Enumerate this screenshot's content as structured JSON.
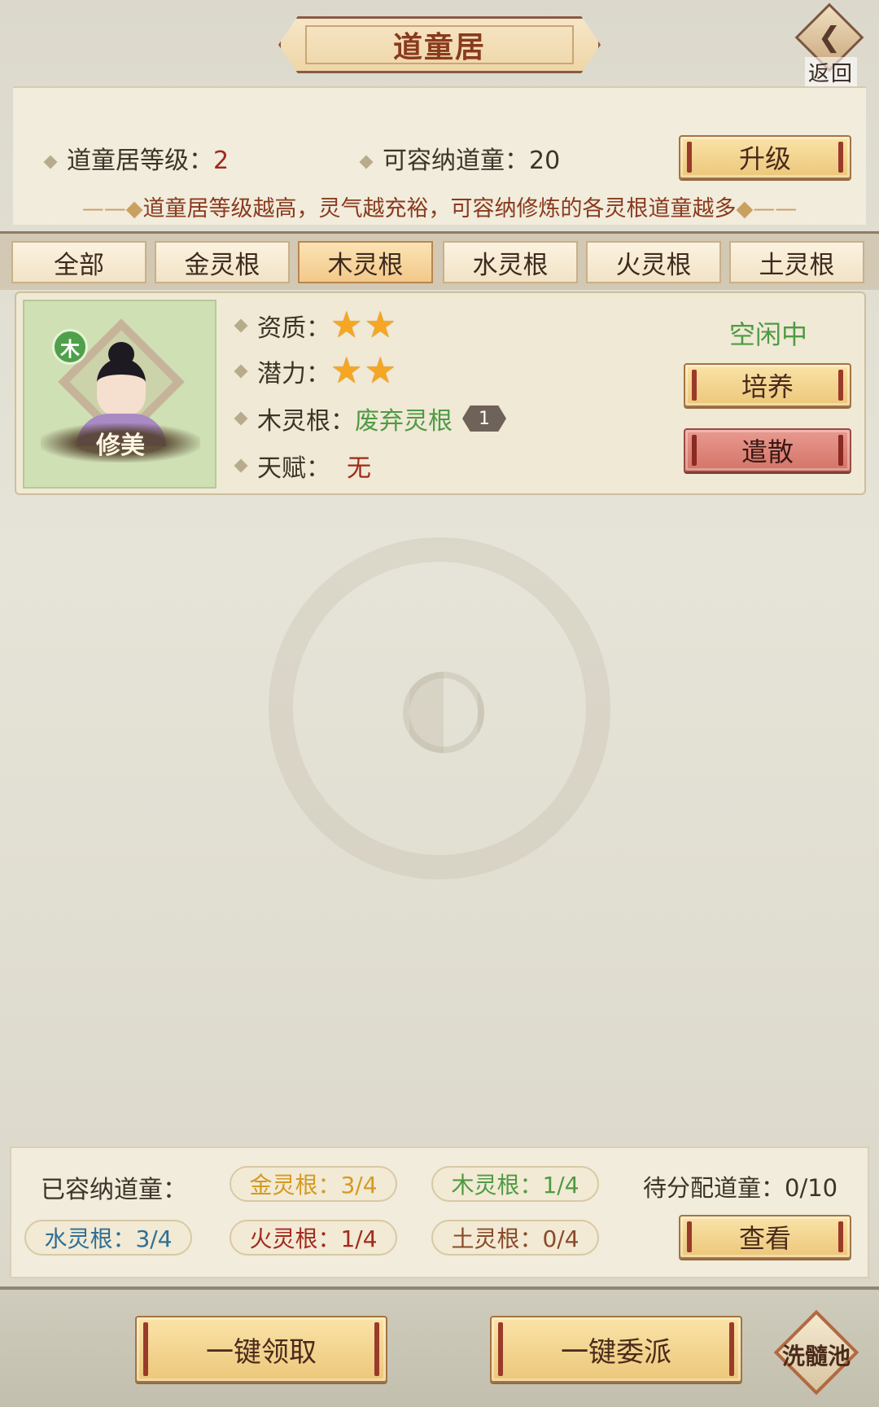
{
  "title": "道童居",
  "back_label": "返回",
  "header": {
    "level_label": "道童居等级：",
    "level_value": "2",
    "capacity_label": "可容纳道童：",
    "capacity_value": "20",
    "upgrade_label": "升级",
    "hint": "道童居等级越高，灵气越充裕，可容纳修炼的各灵根道童越多"
  },
  "tabs": [
    "全部",
    "金灵根",
    "木灵根",
    "水灵根",
    "火灵根",
    "土灵根"
  ],
  "active_tab": "木灵根",
  "card": {
    "element_badge": "木",
    "name": "修美",
    "aptitude_label": "资质：",
    "aptitude_stars": 2,
    "potential_label": "潜力：",
    "potential_stars": 2,
    "root_label": "木灵根：",
    "root_value": "废弃灵根",
    "root_grade": "1",
    "talent_label": "天赋：",
    "talent_value": "无",
    "status": "空闲中",
    "train_label": "培养",
    "dismiss_label": "遣散"
  },
  "summary": {
    "accommodated_label": "已容纳道童：",
    "gold": "金灵根：3/4",
    "wood": "木灵根：1/4",
    "water": "水灵根：3/4",
    "fire": "火灵根：1/4",
    "earth": "土灵根：0/4",
    "pending": "待分配道童：0/10",
    "view_label": "查看"
  },
  "footer": {
    "claim_all": "一键领取",
    "assign_all": "一键委派",
    "wash_pool": "洗髓池"
  },
  "colors": {
    "gold": "#d49a24",
    "wood": "#4f9a44",
    "water": "#2f6f94",
    "fire": "#a32a1e",
    "earth": "#8a4a2a",
    "accent": "#8a3a1e"
  }
}
